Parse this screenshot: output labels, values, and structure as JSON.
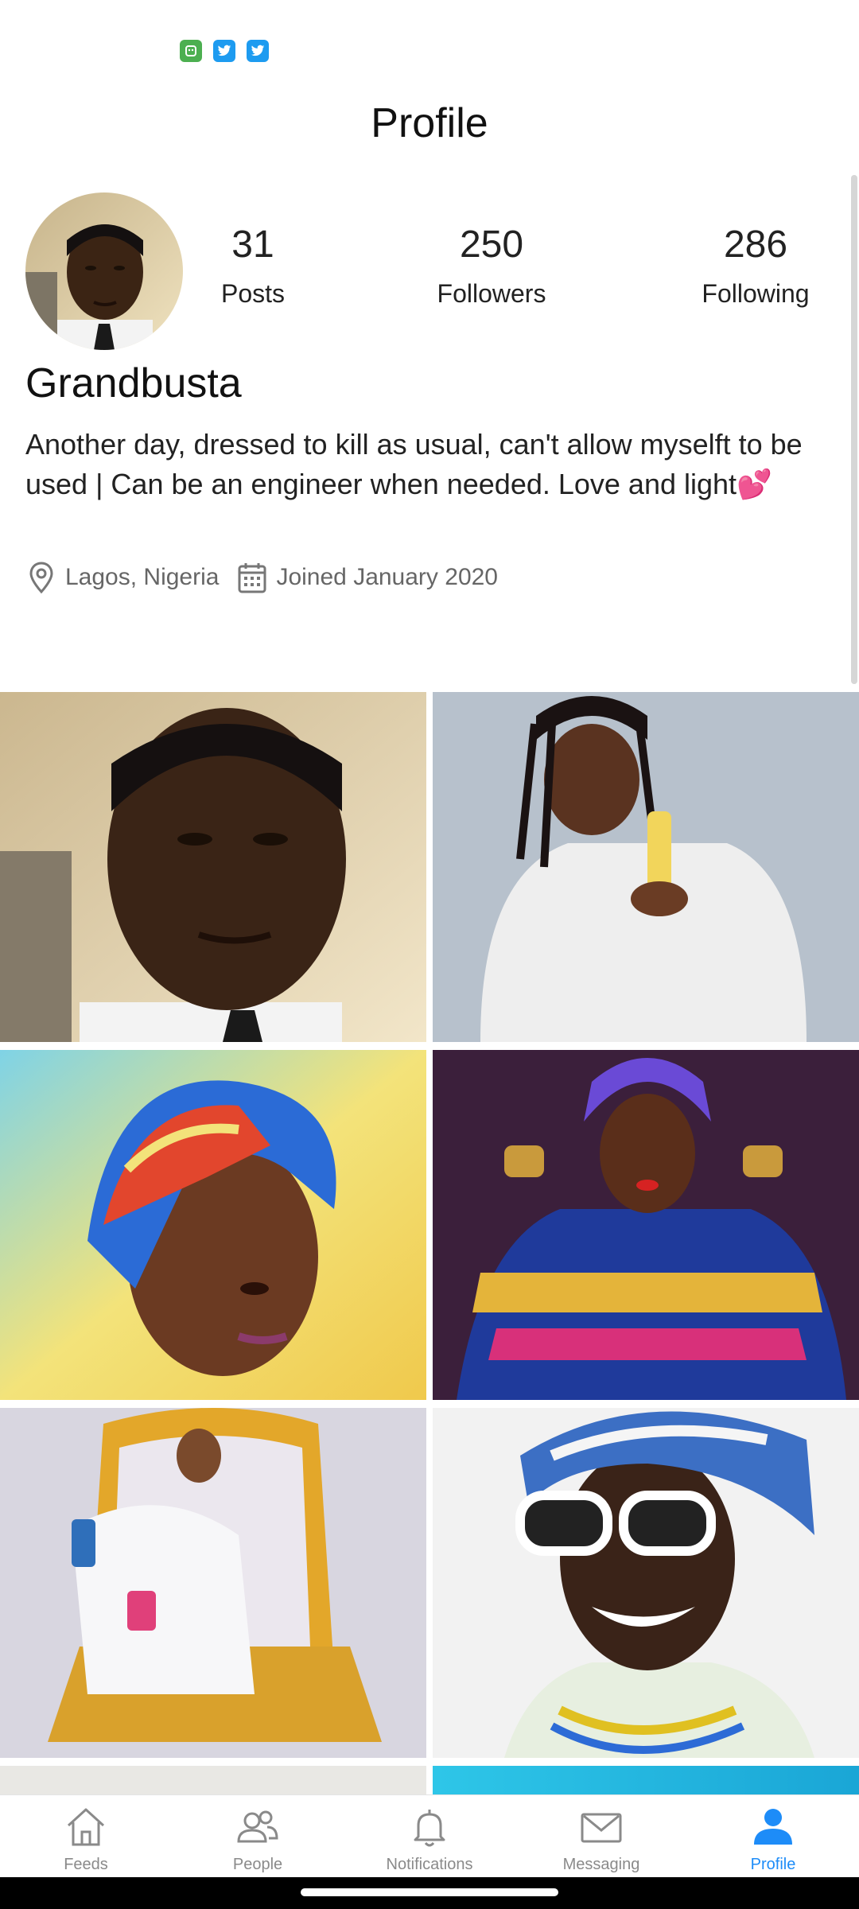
{
  "status_bar": {
    "icons": [
      "app-notification-icon",
      "twitter-icon",
      "twitter-icon"
    ]
  },
  "header": {
    "title": "Profile"
  },
  "profile": {
    "stats": [
      {
        "value": "31",
        "label": "Posts"
      },
      {
        "value": "250",
        "label": "Followers"
      },
      {
        "value": "286",
        "label": "Following"
      }
    ],
    "username": "Grandbusta",
    "bio": "Another day, dressed to kill as usual, can't allow myselft to be used | Can be an engineer when needed. Love and light",
    "bio_emoji": "💕",
    "location": "Lagos, Nigeria",
    "joined": "Joined January 2020"
  },
  "posts_grid": {
    "tiles": [
      "selfie-man-photo",
      "woman-bathrobe-product-photo",
      "woman-headwrap-painting-photo",
      "woman-purple-headwrap-photo",
      "woman-golden-throne-photo",
      "woman-sunglasses-headwrap-photo",
      "partial-photo",
      "partial-blue-photo"
    ]
  },
  "bottom_nav": {
    "items": [
      {
        "label": "Feeds",
        "icon": "home-icon"
      },
      {
        "label": "People",
        "icon": "people-icon"
      },
      {
        "label": "Notifications",
        "icon": "bell-icon"
      },
      {
        "label": "Messaging",
        "icon": "envelope-icon"
      },
      {
        "label": "Profile",
        "icon": "user-icon"
      }
    ],
    "active": "Profile"
  },
  "colors": {
    "accent": "#1d8cf8",
    "inactive": "#8a8a8a"
  }
}
